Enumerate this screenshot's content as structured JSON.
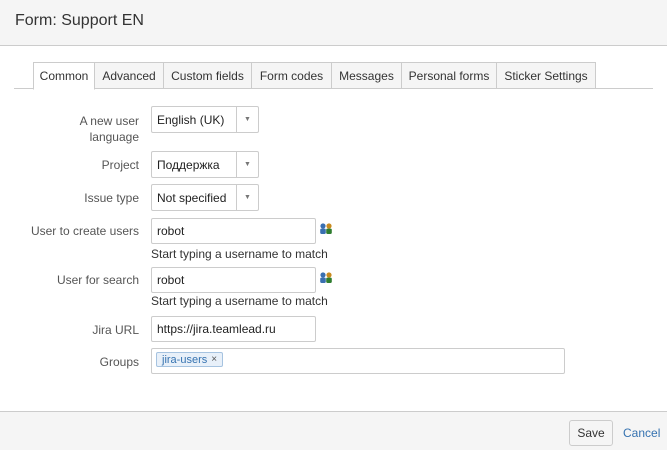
{
  "dialog": {
    "title": "Form: Support EN"
  },
  "tabs": [
    {
      "label": "Common",
      "active": true
    },
    {
      "label": "Advanced"
    },
    {
      "label": "Custom fields"
    },
    {
      "label": "Form codes"
    },
    {
      "label": "Messages"
    },
    {
      "label": "Personal forms"
    },
    {
      "label": "Sticker Settings"
    }
  ],
  "form": {
    "language": {
      "label_line1": "A new user",
      "label_line2": "language",
      "value": "English (UK)"
    },
    "project": {
      "label": "Project",
      "value": "Поддержка"
    },
    "issue_type": {
      "label": "Issue type",
      "value": "Not specified"
    },
    "user_create": {
      "label": "User to create users",
      "value": "robot",
      "hint": "Start typing a username to match"
    },
    "user_search": {
      "label": "User for search",
      "value": "robot",
      "hint": "Start typing a username to match"
    },
    "jira_url": {
      "label": "Jira URL",
      "value": "https://jira.teamlead.ru"
    },
    "groups": {
      "label": "Groups",
      "tags": [
        "jira-users"
      ],
      "remove_glyph": "×"
    }
  },
  "footer": {
    "save_label": "Save",
    "cancel_label": "Cancel"
  },
  "icons": {
    "select_arrow": "▼",
    "user_picker": "users-icon"
  },
  "colors": {
    "link": "#3572b0",
    "tag_bg": "#e8f0f9"
  }
}
